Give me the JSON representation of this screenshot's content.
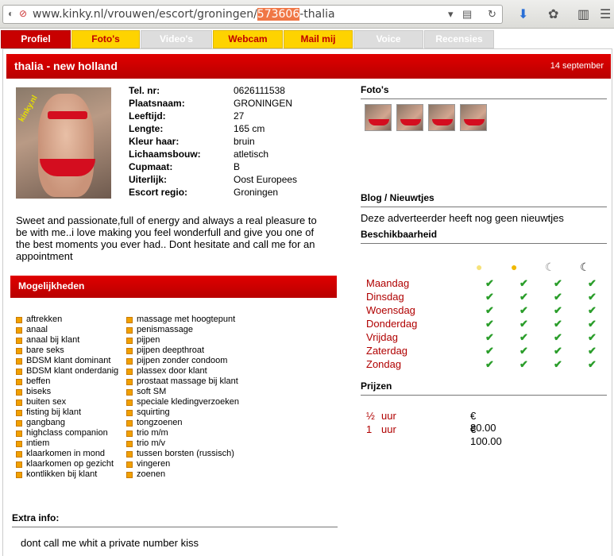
{
  "browser": {
    "url_prefix": "www.kinky.nl/vrouwen/escort/groningen/",
    "url_highlight": "573606",
    "url_suffix": "-thalia"
  },
  "tabs": [
    {
      "label": "Profiel",
      "state": "active"
    },
    {
      "label": "Foto's",
      "state": "yellow"
    },
    {
      "label": "Video's",
      "state": "grey"
    },
    {
      "label": "Webcam",
      "state": "yellow"
    },
    {
      "label": "Mail mij",
      "state": "yellow"
    },
    {
      "label": "Voice",
      "state": "grey"
    },
    {
      "label": "Recensies",
      "state": "grey"
    }
  ],
  "header": {
    "title": "thalia - new holland",
    "date": "14 september"
  },
  "photo_watermark": "kinky.nl",
  "profile": [
    {
      "k": "Tel. nr:",
      "v": "0626111538"
    },
    {
      "k": "Plaatsnaam:",
      "v": "GRONINGEN"
    },
    {
      "k": "Leeftijd:",
      "v": "27"
    },
    {
      "k": "Lengte:",
      "v": "165 cm"
    },
    {
      "k": "Kleur haar:",
      "v": "bruin"
    },
    {
      "k": "Lichaamsbouw:",
      "v": "atletisch"
    },
    {
      "k": "Cupmaat:",
      "v": "B"
    },
    {
      "k": "Uiterlijk:",
      "v": "Oost Europees"
    },
    {
      "k": "Escort regio:",
      "v": "Groningen"
    }
  ],
  "description": "Sweet and passionate,full of energy and always a real pleasure to be with me..i love making you feel wonderfull and give you one of the best moments you ever had.. Dont hesitate and call me for an appointment",
  "mogelijkheden": {
    "title": "Mogelijkheden",
    "col1": [
      "aftrekken",
      "anaal",
      "anaal bij klant",
      "bare seks",
      "BDSM klant dominant",
      "BDSM klant onderdanig",
      "beffen",
      "biseks",
      "buiten sex",
      "fisting bij klant",
      "gangbang",
      "highclass companion",
      "intiem",
      "klaarkomen in mond",
      "klaarkomen op gezicht",
      "kontlikken bij klant"
    ],
    "col2": [
      "massage met hoogtepunt",
      "penismassage",
      "pijpen",
      "pijpen deepthroat",
      "pijpen zonder condoom",
      "plassex door klant",
      "prostaat massage bij klant",
      "soft SM",
      "speciale kledingverzoeken",
      "squirting",
      "tongzoenen",
      "trio m/m",
      "trio m/v",
      "tussen borsten (russisch)",
      "vingeren",
      "zoenen"
    ]
  },
  "extra": {
    "label": "Extra info:",
    "text": "dont call me whit a private number kiss"
  },
  "fotos": {
    "label": "Foto's"
  },
  "blog": {
    "label": "Blog / Nieuwtjes",
    "text": "Deze adverteerder heeft nog geen nieuwtjes"
  },
  "beschikbaarheid": {
    "label": "Beschikbaarheid",
    "days": [
      "Maandag",
      "Dinsdag",
      "Woensdag",
      "Donderdag",
      "Vrijdag",
      "Zaterdag",
      "Zondag"
    ]
  },
  "prijzen": {
    "label": "Prijzen",
    "rows": [
      {
        "dur": "½",
        "unit": "uur",
        "price": "€ 80.00"
      },
      {
        "dur": "1",
        "unit": "uur",
        "price": "€ 100.00"
      }
    ]
  },
  "colors": {
    "accent_red": "#c80000",
    "tab_yellow": "#fed300",
    "check_green": "#2a9d2a"
  }
}
